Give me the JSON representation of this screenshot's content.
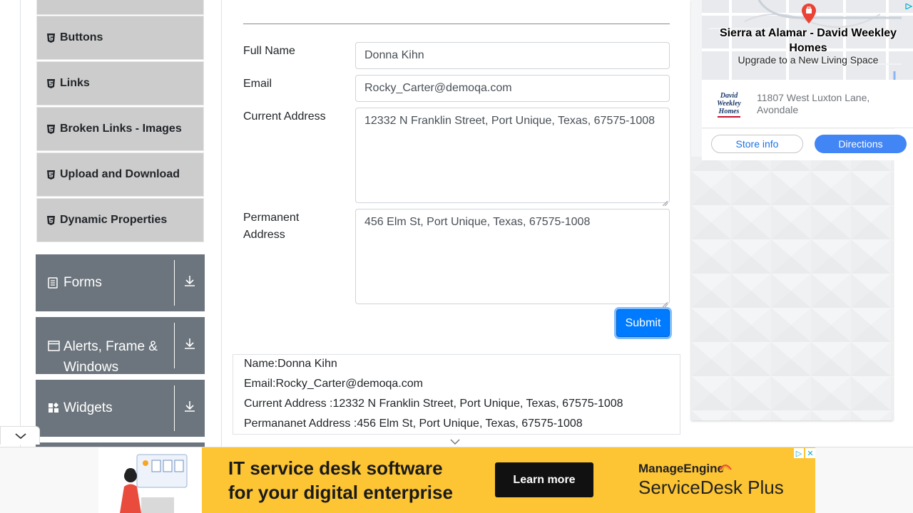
{
  "sidebar": {
    "items": [
      {
        "label": "Buttons"
      },
      {
        "label": "Links"
      },
      {
        "label": "Broken Links - Images"
      },
      {
        "label": "Upload and Download"
      },
      {
        "label": "Dynamic Properties"
      }
    ],
    "groups": [
      {
        "label": "Forms",
        "icon": "form-icon"
      },
      {
        "label": "Alerts, Frame & Windows",
        "icon": "window-icon"
      },
      {
        "label": "Widgets",
        "icon": "widgets-icon"
      }
    ]
  },
  "form": {
    "full_name_label": "Full Name",
    "full_name_value": "Donna Kihn",
    "email_label": "Email",
    "email_value": "Rocky_Carter@demoqa.com",
    "current_address_label": "Current Address",
    "current_address_value": "12332 N Franklin Street, Port Unique, Texas, 67575-1008",
    "permanent_address_label_1": "Permanent",
    "permanent_address_label_2": "Address",
    "permanent_address_value": "456 Elm St, Port Unique, Texas, 67575-1008",
    "submit_label": "Submit"
  },
  "output": {
    "name": "Name:Donna Kihn",
    "email": "Email:Rocky_Carter@demoqa.com",
    "current_address": "Current Address :12332 N Franklin Street, Port Unique, Texas, 67575-1008",
    "permanent_address": "Permananet Address :456 Elm St, Port Unique, Texas, 67575-1008"
  },
  "right_ad": {
    "title": "Sierra at Alamar - David Weekley Homes",
    "subtitle": "Upgrade to a New Living Space",
    "logo_lines": [
      "David",
      "Weekley",
      "Homes"
    ],
    "address": "11807 West Luxton Lane, Avondale",
    "store_info_label": "Store info",
    "directions_label": "Directions"
  },
  "bottom_ad": {
    "headline_1": "IT service desk software",
    "headline_2": "for your digital enterprise",
    "cta": "Learn more",
    "brand": "ManageEngine",
    "product": "ServiceDesk Plus",
    "accent": "#fdc533"
  }
}
